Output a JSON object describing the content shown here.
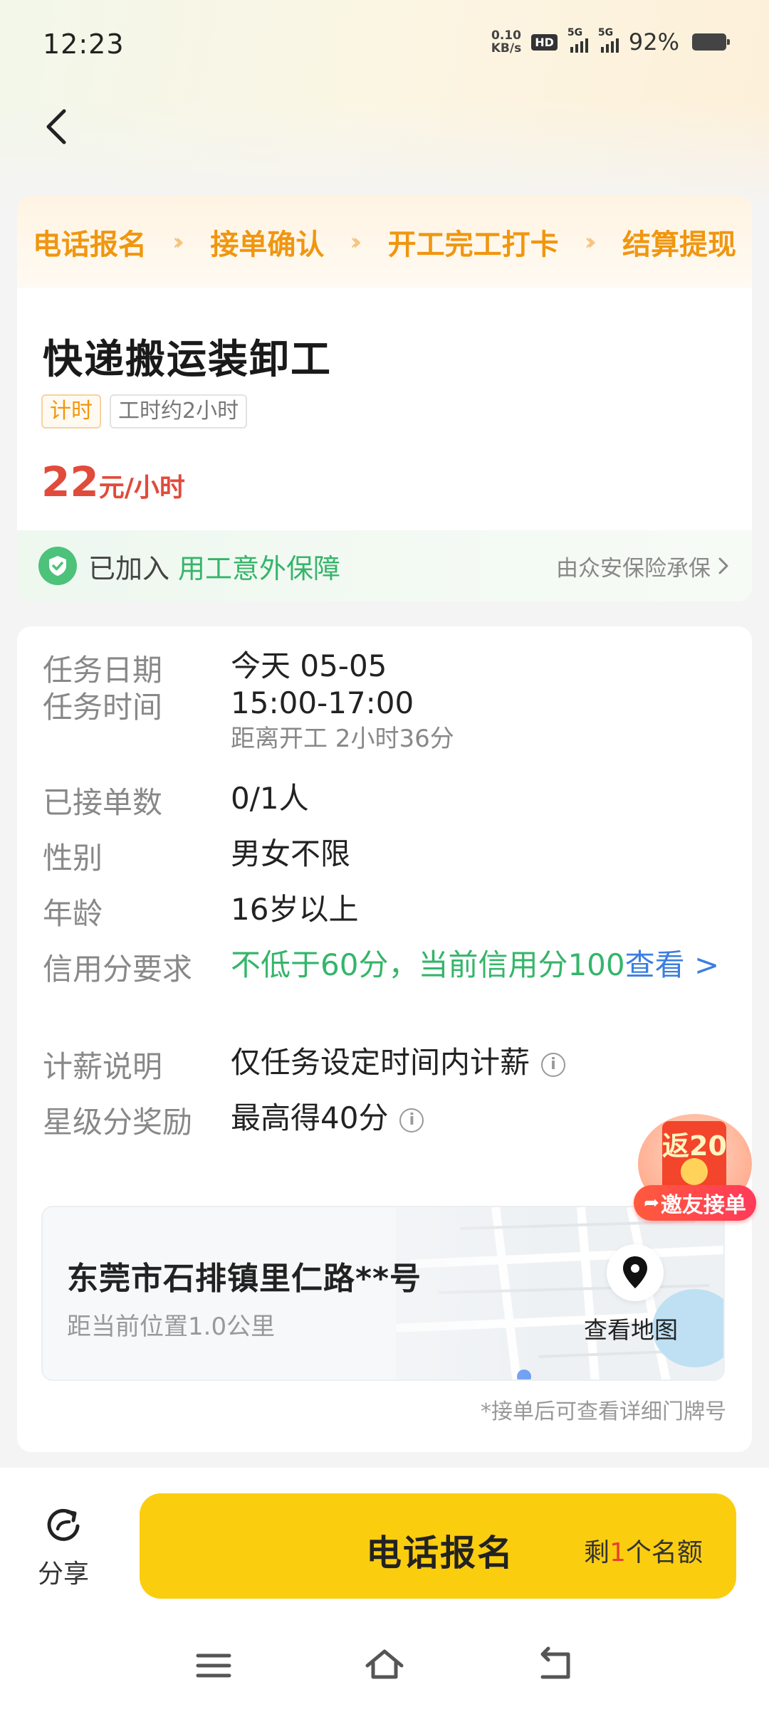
{
  "status_bar": {
    "time": "12:23",
    "net_speed_value": "0.10",
    "net_speed_unit": "KB/s",
    "hd": "HD",
    "signal1": "5G",
    "signal2": "5G",
    "battery": "92%"
  },
  "steps": [
    "电话报名",
    "接单确认",
    "开工完工打卡",
    "结算提现"
  ],
  "job": {
    "title": "快递搬运装卸工",
    "tags": [
      "计时",
      "工时约2小时"
    ],
    "price_num": "22",
    "price_unit": "元/小时"
  },
  "insurance": {
    "prefix": "已加入",
    "link": "用工意外保障",
    "provider": "由众安保险承保"
  },
  "details": {
    "date_label": "任务日期",
    "date_value": "今天 05-05",
    "time_label": "任务时间",
    "time_value": "15:00-17:00",
    "time_sub": "距离开工 2小时36分",
    "taken_label": "已接单数",
    "taken_value": "0/1人",
    "gender_label": "性别",
    "gender_value": "男女不限",
    "age_label": "年龄",
    "age_value": "16岁以上",
    "credit_label": "信用分要求",
    "credit_value": "不低于60分，当前信用分100",
    "credit_link": "查看 >",
    "pay_label": "计薪说明",
    "pay_value": "仅任务设定时间内计薪",
    "star_label": "星级分奖励",
    "star_value": "最高得40分"
  },
  "address": {
    "title": "东莞市石排镇里仁路**号",
    "distance": "距当前位置1.0公里",
    "map_label": "查看地图",
    "note": "*接单后可查看详细门牌号"
  },
  "float_badge": {
    "amount": "返20",
    "label": "邀友接单"
  },
  "bottom": {
    "share_label": "分享",
    "cta_label": "电话报名",
    "quota_prefix": "剩",
    "quota_num": "1",
    "quota_suffix": "个名额"
  },
  "colors": {
    "accent_orange": "#f0960f",
    "price_red": "#e14b3b",
    "green": "#35b56a",
    "link_blue": "#3b7ee0",
    "cta_yellow": "#fbcd0f"
  }
}
